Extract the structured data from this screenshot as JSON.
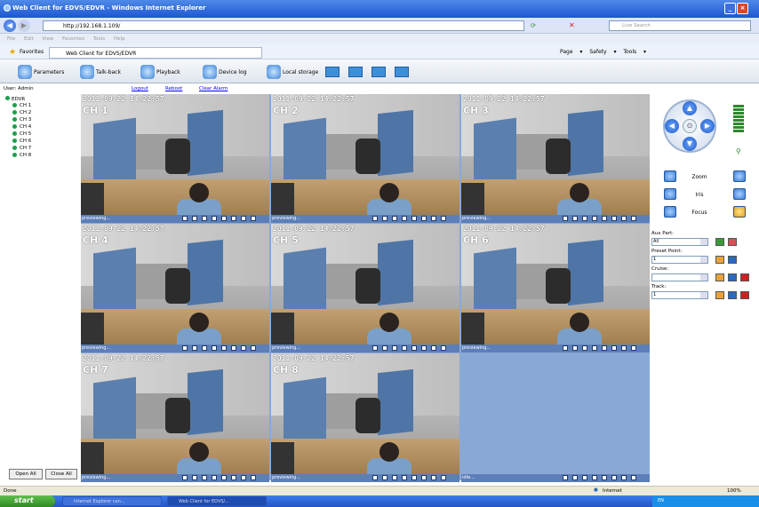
{
  "window": {
    "title": "Web Client for EDVS/EDVR - Windows Internet Explorer"
  },
  "address": {
    "url": "http://192.168.1.109/",
    "search_placeholder": "Live Search"
  },
  "menu": {
    "text": "File Edit View Favorites Tools Help"
  },
  "favorites": {
    "label": "Favorites",
    "tab": "Web Client for EDVS/EDVR",
    "tools": "Page ▾ Safety ▾ Tools ▾"
  },
  "toolbar": {
    "parameters": "Parameters",
    "talkback": "Talk-back",
    "playback": "Playback",
    "devicelog": "Device log",
    "localstorage": "Local storage"
  },
  "user": {
    "label": "User: Admin",
    "logout": "Logout",
    "reboot": "Reboot",
    "clear_alarm": "Clear Alarm"
  },
  "tree": {
    "root": "EDVR",
    "channels": [
      "CH 1",
      "CH 2",
      "CH 3",
      "CH 4",
      "CH 5",
      "CH 6",
      "CH 7",
      "CH 8"
    ]
  },
  "buttons": {
    "open_all": "Open All",
    "close_all": "Close All"
  },
  "cells": [
    {
      "ch": "CH 1",
      "ts": "2011-09-22 14:22:57",
      "status": "previewing..."
    },
    {
      "ch": "CH 2",
      "ts": "2011-09-22 14:22:57",
      "status": "previewing..."
    },
    {
      "ch": "CH 3",
      "ts": "2011-09-22 14:22:57",
      "status": "previewing..."
    },
    {
      "ch": "CH 4",
      "ts": "2011-09-22 14:22:57",
      "status": "previewing..."
    },
    {
      "ch": "CH 5",
      "ts": "2011-09-22 14:22:57",
      "status": "previewing..."
    },
    {
      "ch": "CH 6",
      "ts": "2011-09-22 14:22:57",
      "status": "previewing..."
    },
    {
      "ch": "CH 7",
      "ts": "2011-09-22 14:22:57",
      "status": "previewing..."
    },
    {
      "ch": "CH 8",
      "ts": "2011-09-22 14:22:57",
      "status": "previewing..."
    },
    {
      "ch": "",
      "ts": "",
      "status": "idle..."
    }
  ],
  "ptz": {
    "zoom": "Zoom",
    "iris": "Iris",
    "focus": "Focus",
    "aux_label": "Aux Part:",
    "aux_value": "All",
    "preset_label": "Preset Point:",
    "preset_value": "1",
    "cruise_label": "Cruise:",
    "cruise_value": "",
    "track_label": "Track:",
    "track_value": "1"
  },
  "statusbar": {
    "left": "Done",
    "zone": "Internet",
    "zoom": "100%"
  },
  "taskbar": {
    "start": "start",
    "task1": "Internet Explorer can...",
    "task2": "Web Client for EDVS/...",
    "tray": "EN"
  }
}
